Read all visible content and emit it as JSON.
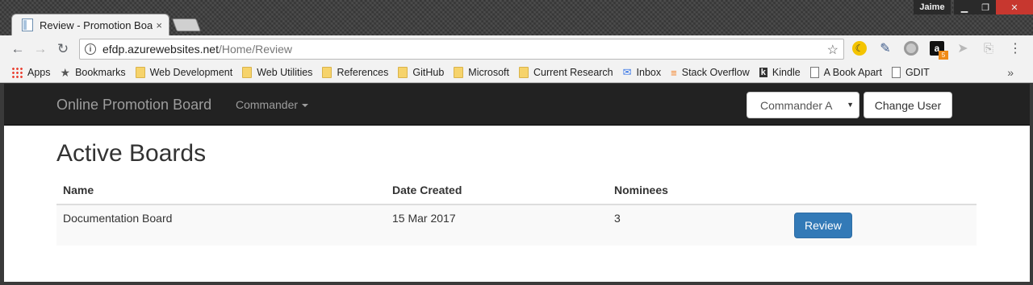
{
  "browser": {
    "tab_title": "Review - Promotion Boar",
    "tab_close": "×",
    "profile_name": "Jaime",
    "url_host": "efdp.azurewebsites.net",
    "url_path": "/Home/Review",
    "ext_badge": "5"
  },
  "bookmarks": [
    {
      "label": "Apps",
      "icon": "apps-icon"
    },
    {
      "label": "Bookmarks",
      "icon": "star-icon"
    },
    {
      "label": "Web Development",
      "icon": "folder-icon"
    },
    {
      "label": "Web Utilities",
      "icon": "folder-icon"
    },
    {
      "label": "References",
      "icon": "folder-icon"
    },
    {
      "label": "GitHub",
      "icon": "folder-icon"
    },
    {
      "label": "Microsoft",
      "icon": "folder-icon"
    },
    {
      "label": "Current Research",
      "icon": "folder-icon"
    },
    {
      "label": "Inbox",
      "icon": "inbox-icon"
    },
    {
      "label": "Stack Overflow",
      "icon": "stackoverflow-icon"
    },
    {
      "label": "Kindle",
      "icon": "kindle-icon"
    },
    {
      "label": "A Book Apart",
      "icon": "page-icon"
    },
    {
      "label": "GDIT",
      "icon": "page-icon"
    }
  ],
  "app": {
    "brand": "Online Promotion Board",
    "nav_dropdown": "Commander",
    "user_select": "Commander A",
    "change_user": "Change User"
  },
  "page": {
    "heading": "Active Boards",
    "columns": [
      "Name",
      "Date Created",
      "Nominees"
    ],
    "rows": [
      {
        "name": "Documentation Board",
        "date": "15 Mar 2017",
        "nominees": "3",
        "action": "Review"
      }
    ]
  }
}
